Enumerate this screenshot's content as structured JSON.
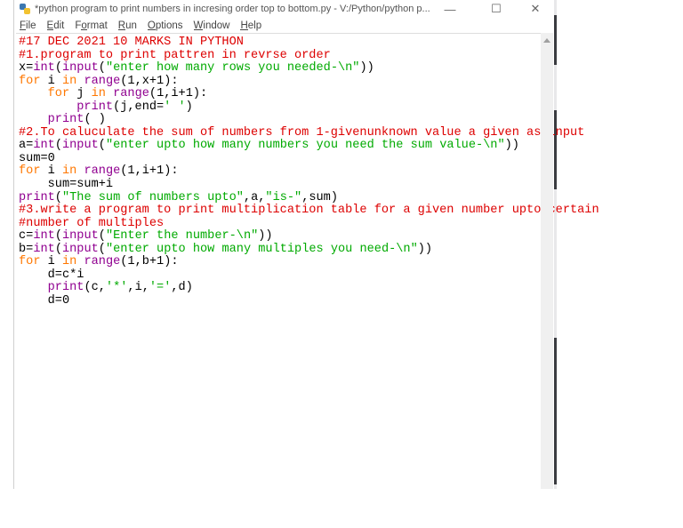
{
  "window": {
    "title": "*python program to  print numbers in incresing order top to bottom.py - V:/Python/python p...",
    "controls": {
      "minimize": "—",
      "maximize": "☐",
      "close": "✕"
    }
  },
  "menu": [
    {
      "label": "File",
      "u": "F",
      "rest": "ile"
    },
    {
      "label": "Edit",
      "u": "E",
      "rest": "dit"
    },
    {
      "label": "Format",
      "u": "",
      "pre": "F",
      "uc": "o",
      "rest": "rmat"
    },
    {
      "label": "Run",
      "u": "R",
      "rest": "un"
    },
    {
      "label": "Options",
      "u": "O",
      "rest": "ptions"
    },
    {
      "label": "Window",
      "u": "W",
      "rest": "indow"
    },
    {
      "label": "Help",
      "u": "H",
      "rest": "elp"
    }
  ],
  "colors": {
    "comment": "#dd0000",
    "keyword": "#ff7700",
    "builtin": "#900090",
    "string": "#00aa00",
    "default": "#000000"
  },
  "code": [
    [
      [
        "comment",
        "#17 DEC 2021 10 MARKS IN PYTHON"
      ]
    ],
    [
      [
        "comment",
        "#1.program to print pattren in revrse order"
      ]
    ],
    [
      [
        "default",
        "x="
      ],
      [
        "builtin",
        "int"
      ],
      [
        "default",
        "("
      ],
      [
        "builtin",
        "input"
      ],
      [
        "default",
        "("
      ],
      [
        "string",
        "\"enter how many rows you needed-\\n\""
      ],
      [
        "default",
        "))"
      ]
    ],
    [
      [
        "keyword",
        "for"
      ],
      [
        "default",
        " i "
      ],
      [
        "keyword",
        "in"
      ],
      [
        "default",
        " "
      ],
      [
        "builtin",
        "range"
      ],
      [
        "default",
        "(1,x+1):"
      ]
    ],
    [
      [
        "default",
        "    "
      ],
      [
        "keyword",
        "for"
      ],
      [
        "default",
        " j "
      ],
      [
        "keyword",
        "in"
      ],
      [
        "default",
        " "
      ],
      [
        "builtin",
        "range"
      ],
      [
        "default",
        "(1,i+1):"
      ]
    ],
    [
      [
        "default",
        "        "
      ],
      [
        "builtin",
        "print"
      ],
      [
        "default",
        "(j,end="
      ],
      [
        "string",
        "' '"
      ],
      [
        "default",
        ")"
      ]
    ],
    [
      [
        "default",
        "    "
      ],
      [
        "builtin",
        "print"
      ],
      [
        "default",
        "( )"
      ]
    ],
    [
      [
        "comment",
        "#2.To caluculate the sum of numbers from 1-givenunknown value a given as input"
      ]
    ],
    [
      [
        "default",
        "a="
      ],
      [
        "builtin",
        "int"
      ],
      [
        "default",
        "("
      ],
      [
        "builtin",
        "input"
      ],
      [
        "default",
        "("
      ],
      [
        "string",
        "\"enter upto how many numbers you need the sum value-\\n\""
      ],
      [
        "default",
        "))"
      ]
    ],
    [
      [
        "default",
        "sum=0"
      ]
    ],
    [
      [
        "keyword",
        "for"
      ],
      [
        "default",
        " i "
      ],
      [
        "keyword",
        "in"
      ],
      [
        "default",
        " "
      ],
      [
        "builtin",
        "range"
      ],
      [
        "default",
        "(1,i+1):"
      ]
    ],
    [
      [
        "default",
        "    sum=sum+i"
      ]
    ],
    [
      [
        "builtin",
        "print"
      ],
      [
        "default",
        "("
      ],
      [
        "string",
        "\"The sum of numbers upto\""
      ],
      [
        "default",
        ",a,"
      ],
      [
        "string",
        "\"is-\""
      ],
      [
        "default",
        ",sum)"
      ]
    ],
    [
      [
        "comment",
        "#3.write a program to print multiplication table for a given number upto certain"
      ]
    ],
    [
      [
        "comment",
        "#number of multiples"
      ]
    ],
    [
      [
        "default",
        "c="
      ],
      [
        "builtin",
        "int"
      ],
      [
        "default",
        "("
      ],
      [
        "builtin",
        "input"
      ],
      [
        "default",
        "("
      ],
      [
        "string",
        "\"Enter the number-\\n\""
      ],
      [
        "default",
        "))"
      ]
    ],
    [
      [
        "default",
        "b="
      ],
      [
        "builtin",
        "int"
      ],
      [
        "default",
        "("
      ],
      [
        "builtin",
        "input"
      ],
      [
        "default",
        "("
      ],
      [
        "string",
        "\"enter upto how many multiples you need-\\n\""
      ],
      [
        "default",
        "))"
      ]
    ],
    [
      [
        "keyword",
        "for"
      ],
      [
        "default",
        " i "
      ],
      [
        "keyword",
        "in"
      ],
      [
        "default",
        " "
      ],
      [
        "builtin",
        "range"
      ],
      [
        "default",
        "(1,b+1):"
      ]
    ],
    [
      [
        "default",
        "    d=c*i"
      ]
    ],
    [
      [
        "default",
        "    "
      ],
      [
        "builtin",
        "print"
      ],
      [
        "default",
        "(c,"
      ],
      [
        "string",
        "'*'"
      ],
      [
        "default",
        ",i,"
      ],
      [
        "string",
        "'='"
      ],
      [
        "default",
        ",d)"
      ]
    ],
    [
      [
        "default",
        "    d=0"
      ]
    ]
  ]
}
